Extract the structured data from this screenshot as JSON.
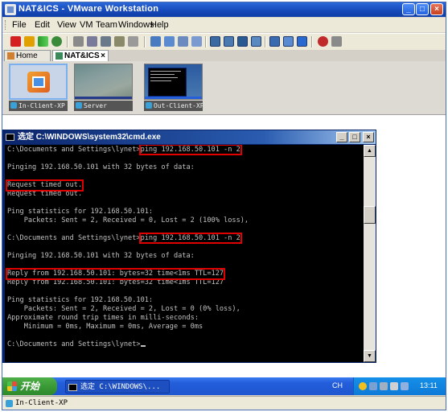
{
  "window": {
    "title": "NAT&ICS - VMware Workstation",
    "controls": {
      "minimize": "_",
      "maximize": "□",
      "close": "×"
    }
  },
  "menubar": {
    "items": [
      "File",
      "Edit",
      "View",
      "VM",
      "Team",
      "Windows",
      "Help"
    ]
  },
  "tabs": [
    {
      "label": "Home",
      "icon": "home-icon"
    },
    {
      "label": "NAT&ICS",
      "icon": "team-icon",
      "close": "×"
    }
  ],
  "thumbnails": [
    {
      "label": "In-Client-XP"
    },
    {
      "label": "Server"
    },
    {
      "label": "Out-Client-XP"
    }
  ],
  "cmd": {
    "title": "选定 C:\\WINDOWS\\system32\\cmd.exe",
    "controls": {
      "minimize": "_",
      "maximize": "□",
      "close": "×"
    },
    "lines": [
      {
        "prefix": "C:\\Documents and Settings\\lynet>",
        "text": "ping 192.168.50.101 -n 2"
      },
      {
        "text": ""
      },
      {
        "text": "Pinging 192.168.50.101 with 32 bytes of data:"
      },
      {
        "text": ""
      },
      {
        "text": "Request timed out."
      },
      {
        "text": "Request timed out."
      },
      {
        "text": ""
      },
      {
        "text": "Ping statistics for 192.168.50.101:"
      },
      {
        "text": "    Packets: Sent = 2, Received = 0, Lost = 2 (100% loss),"
      },
      {
        "text": ""
      },
      {
        "prefix": "C:\\Documents and Settings\\lynet>",
        "text": "ping 192.168.50.101 -n 2"
      },
      {
        "text": ""
      },
      {
        "text": "Pinging 192.168.50.101 with 32 bytes of data:"
      },
      {
        "text": ""
      },
      {
        "text": "Reply from 192.168.50.101: bytes=32 time<1ms TTL=127"
      },
      {
        "text": "Reply from 192.168.50.101: bytes=32 time<1ms TTL=127"
      },
      {
        "text": ""
      },
      {
        "text": "Ping statistics for 192.168.50.101:"
      },
      {
        "text": "    Packets: Sent = 2, Received = 2, Lost = 0 (0% loss),"
      },
      {
        "text": "Approximate round trip times in milli-seconds:"
      },
      {
        "text": "    Minimum = 0ms, Maximum = 0ms, Average = 0ms"
      },
      {
        "text": ""
      },
      {
        "text": "C:\\Documents and Settings\\lynet>"
      }
    ]
  },
  "taskbar": {
    "start_label": "开始",
    "task_label": "选定 C:\\WINDOWS\\...",
    "language": "CH",
    "clock": "13:11"
  },
  "statusbar": {
    "vm_name": "In-Client-XP"
  },
  "colors": {
    "highlight": "#e00000",
    "console_bg": "#000000",
    "console_fg": "#c0c0c0",
    "xp_taskbar": "#245edb",
    "xp_start": "#3a9a35"
  }
}
